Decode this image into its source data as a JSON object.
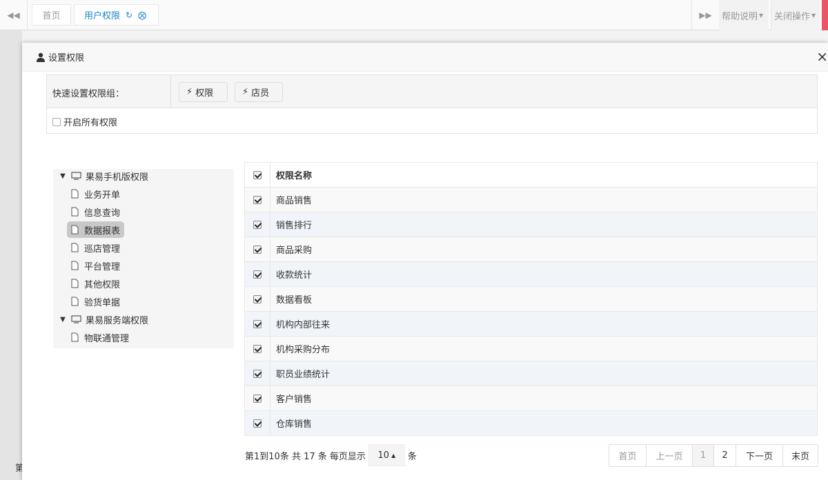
{
  "topbar": {
    "tabs": [
      {
        "label": "首页"
      },
      {
        "label": "用户权限"
      }
    ],
    "help_label": "帮助说明",
    "close_ops_label": "关闭操作",
    "accent_color": "#1c84c6"
  },
  "background": {
    "fragment_text": "第"
  },
  "dialog": {
    "title": "设置权限",
    "close_glyph": "×",
    "quick_group_label": "快速设置权限组：",
    "quick_buttons": [
      {
        "label": "权限",
        "icon": "bolt-icon"
      },
      {
        "label": "店员",
        "icon": "bolt-icon"
      }
    ],
    "enable_all_label": "开启所有权限"
  },
  "tree": {
    "groups": [
      {
        "label": "果易手机版权限",
        "expanded": true,
        "children": [
          "业务开单",
          "信息查询",
          "数据报表",
          "巡店管理",
          "平台管理",
          "其他权限",
          "验货单据"
        ]
      },
      {
        "label": "果易服务端权限",
        "expanded": true,
        "children": [
          "物联通管理"
        ]
      }
    ],
    "selected": "数据报表"
  },
  "table": {
    "header": "权限名称",
    "rows": [
      "商品销售",
      "销售排行",
      "商品采购",
      "收款统计",
      "数据看板",
      "机构内部往来",
      "机构采购分布",
      "职员业绩统计",
      "客户销售",
      "仓库销售"
    ]
  },
  "pagination": {
    "info_prefix": "第1到10条 共 17 条 每页显示",
    "page_size": "10",
    "info_suffix": "条",
    "buttons": {
      "first": "首页",
      "prev": "上一页",
      "page1": "1",
      "page2": "2",
      "next": "下一页",
      "last": "末页"
    }
  }
}
